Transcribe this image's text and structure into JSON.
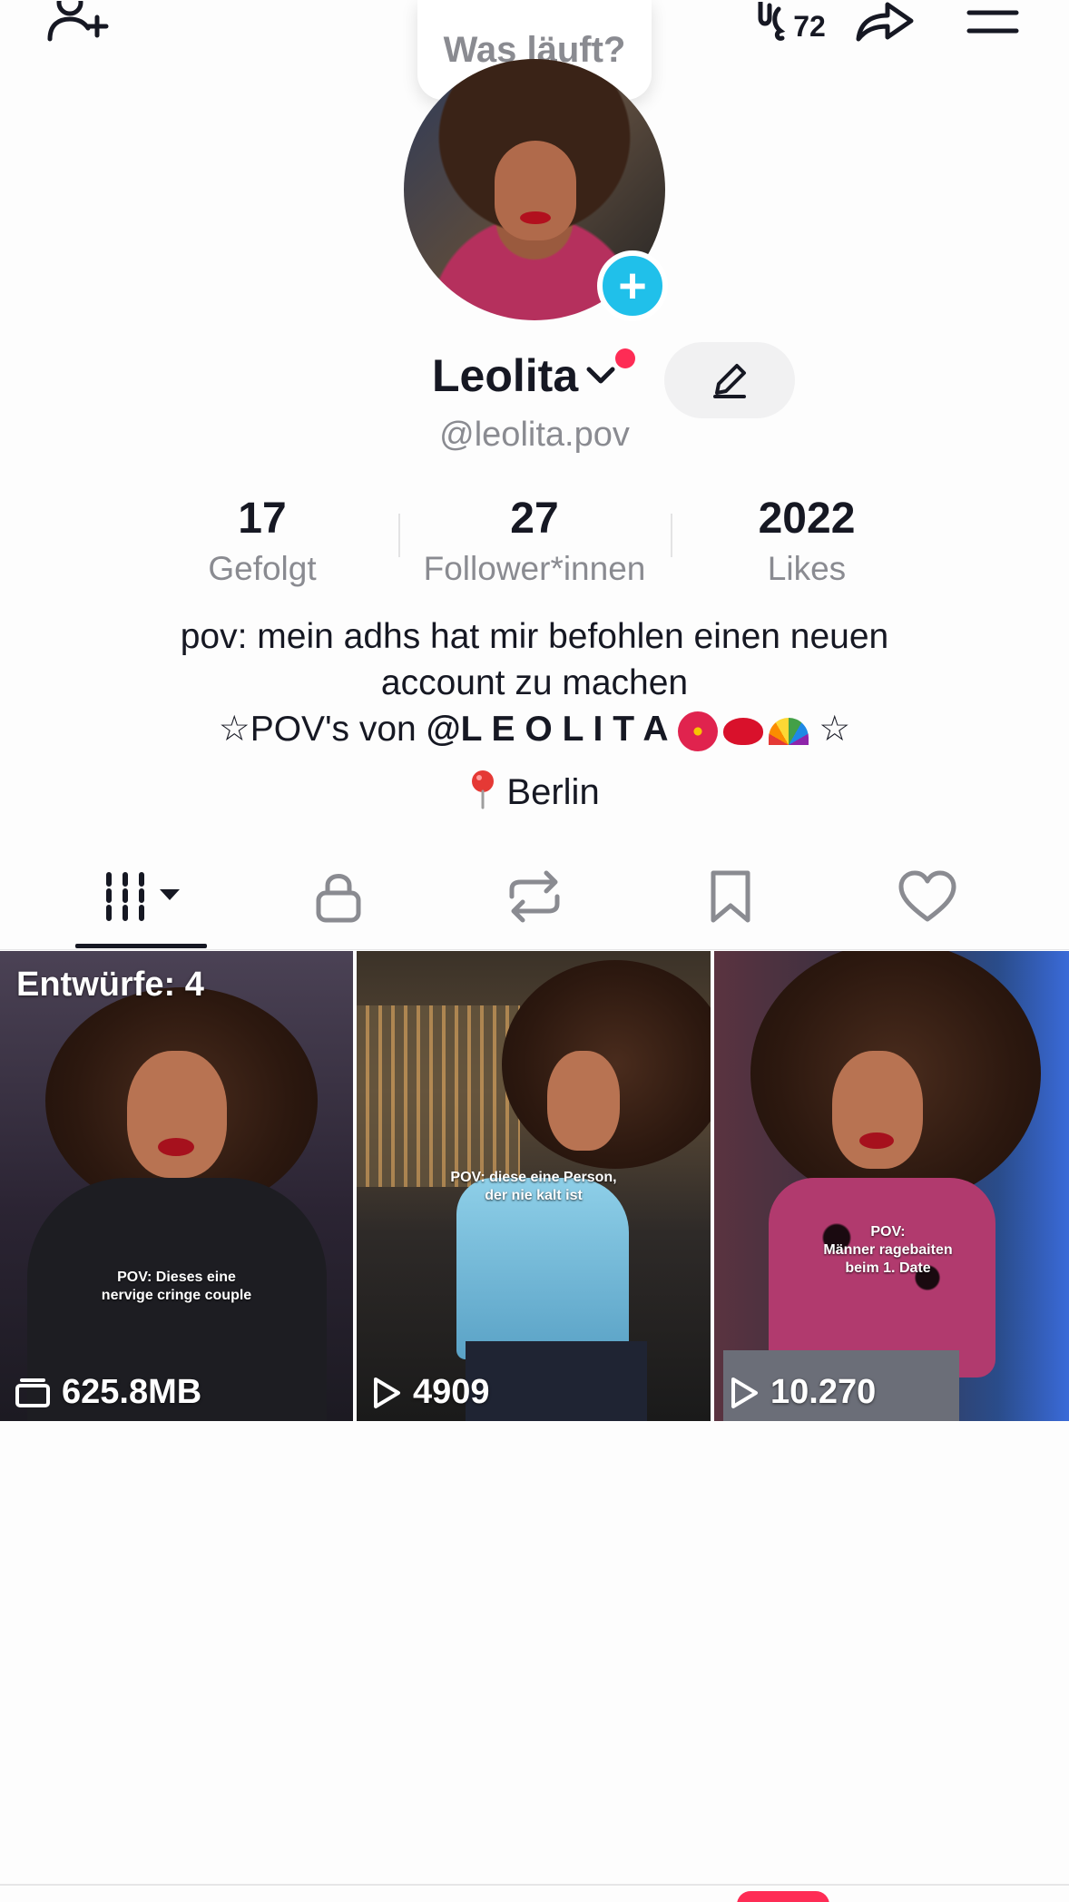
{
  "header": {
    "status_bubble": "Was läuft?",
    "notification_count": "72"
  },
  "profile": {
    "display_name": "Leolita",
    "handle": "@leolita.pov"
  },
  "stats": [
    {
      "value": "17",
      "label": "Gefolgt"
    },
    {
      "value": "27",
      "label": "Follower*innen"
    },
    {
      "value": "2022",
      "label": "Likes"
    }
  ],
  "bio": {
    "line1": "pov: mein adhs hat mir befohlen einen neuen",
    "line2": "account zu machen",
    "line3_prefix": "☆POV's von ",
    "line3_bold": "@L E O L I T A",
    "line3_suffix": " ☆",
    "location": "Berlin"
  },
  "tabs": [
    {
      "name": "videos",
      "icon": "grid-icon",
      "active": true
    },
    {
      "name": "private",
      "icon": "lock-icon"
    },
    {
      "name": "reposts",
      "icon": "repost-icon"
    },
    {
      "name": "favorites",
      "icon": "bookmark-icon"
    },
    {
      "name": "liked",
      "icon": "heart-icon"
    }
  ],
  "videos": [
    {
      "overlay": "Entwürfe: 4",
      "caption_line1": "POV: Dieses eine",
      "caption_line2": "nervige cringe couple",
      "count": "625.8MB",
      "count_icon": "drafts-icon"
    },
    {
      "caption_line1": "POV: diese eine Person,",
      "caption_line2": "der nie kalt ist",
      "count": "4909",
      "count_icon": "play-icon"
    },
    {
      "caption_line1": "POV:",
      "caption_line2": "Männer ragebaiten",
      "caption_line3": "beim 1. Date",
      "count": "10.270",
      "count_icon": "play-icon"
    }
  ],
  "colors": {
    "accent_red": "#fe2c55",
    "accent_cyan": "#20c0ea",
    "secondary_text": "#8a8b91",
    "primary_text": "#161823"
  }
}
